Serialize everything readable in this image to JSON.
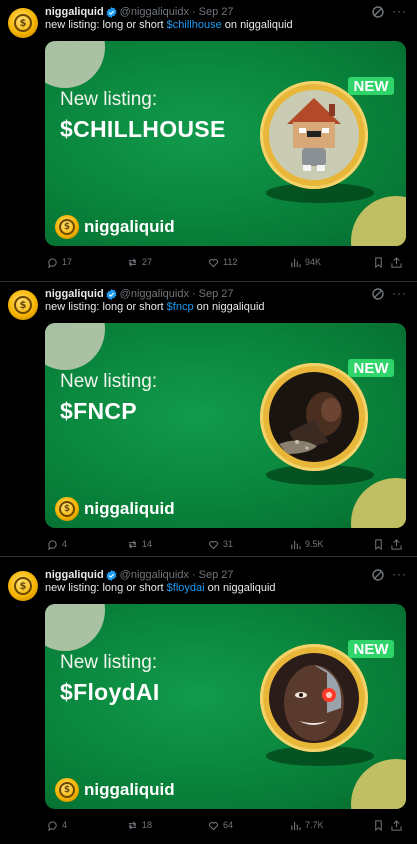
{
  "tweets": [
    {
      "author": "niggaliquid",
      "handle": "@niggaliquidx",
      "date": "Sep 27",
      "text_before": "new listing: long or short ",
      "cashtag": "$chillhouse",
      "text_after": " on niggaliquid",
      "card": {
        "title": "New listing:",
        "ticker": "$CHILLHOUSE",
        "badge": "NEW",
        "brand": "niggaliquid",
        "image": "house-character"
      },
      "stats": {
        "replies": "17",
        "reposts": "27",
        "likes": "112",
        "views": "94K"
      }
    },
    {
      "author": "niggaliquid",
      "handle": "@niggaliquidx",
      "date": "Sep 27",
      "text_before": "new listing: long or short ",
      "cashtag": "$fncp",
      "text_after": " on niggaliquid",
      "card": {
        "title": "New listing:",
        "ticker": "$FNCP",
        "badge": "NEW",
        "brand": "niggaliquid",
        "image": "dark-photo"
      },
      "stats": {
        "replies": "4",
        "reposts": "14",
        "likes": "31",
        "views": "9.5K"
      }
    },
    {
      "author": "niggaliquid",
      "handle": "@niggaliquidx",
      "date": "Sep 27",
      "text_before": "new listing: long or short ",
      "cashtag": "$floydai",
      "text_after": " on niggaliquid",
      "card": {
        "title": "New listing:",
        "ticker": "$FloydAI",
        "badge": "NEW",
        "brand": "niggaliquid",
        "image": "cyborg-face"
      },
      "stats": {
        "replies": "4",
        "reposts": "18",
        "likes": "64",
        "views": "7.7K"
      }
    }
  ],
  "colors": {
    "accent_link": "#1d9bf0",
    "verified": "#1d9bf0",
    "muted": "#71767b",
    "card_green": "#0b8a40",
    "badge_green": "#2fd56a",
    "ring_gold": "#e8b73a"
  },
  "icons": [
    "verified-badge-icon",
    "grok-icon",
    "more-icon",
    "reply-icon",
    "repost-icon",
    "like-icon",
    "views-icon",
    "bookmark-icon",
    "share-icon"
  ]
}
